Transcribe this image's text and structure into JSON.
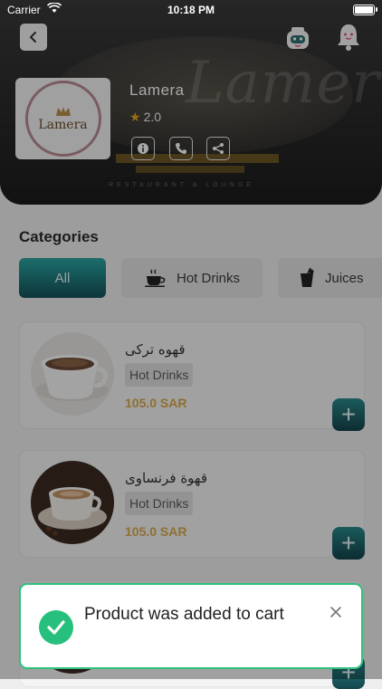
{
  "status_bar": {
    "carrier": "Carrier",
    "time": "10:18 PM"
  },
  "store": {
    "name": "Lamera",
    "rating": "2.0",
    "logo_text": "Lamera",
    "banner_script": "Lamera",
    "banner_subtitle": "RESTAURANT & LOUNGE"
  },
  "categories": {
    "title": "Categories",
    "items": [
      {
        "label": "All",
        "selected": true
      },
      {
        "label": "Hot Drinks",
        "icon": "hot-cup-icon"
      },
      {
        "label": "Juices",
        "icon": "juice-glass-icon"
      }
    ]
  },
  "products": [
    {
      "name": "قهوه تركى",
      "category": "Hot Drinks",
      "price": "105.0 SAR",
      "add_label": "+"
    },
    {
      "name": "قهوة فرنساوى",
      "category": "Hot Drinks",
      "price": "105.0 SAR",
      "add_label": "+"
    }
  ],
  "toast": {
    "message": "Product was added to cart"
  },
  "colors": {
    "accent_teal": "#1f7f85",
    "price": "#d9a94c",
    "success": "#26c07c"
  }
}
